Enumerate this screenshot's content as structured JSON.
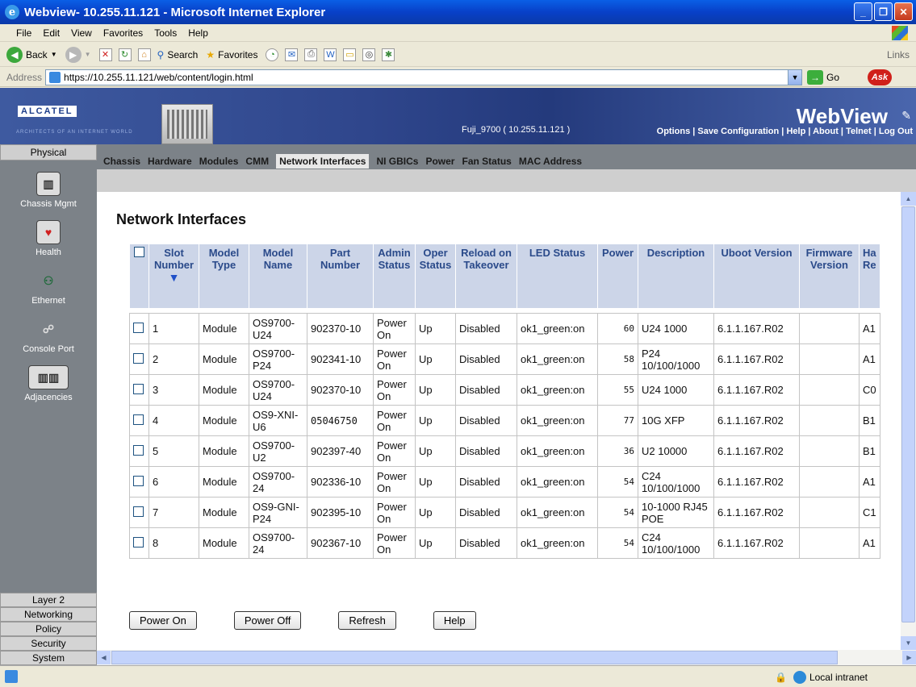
{
  "window": {
    "title": "Webview- 10.255.11.121 - Microsoft Internet Explorer",
    "buttons": [
      "_",
      "❐",
      "✕"
    ]
  },
  "menu": [
    "File",
    "Edit",
    "View",
    "Favorites",
    "Tools",
    "Help"
  ],
  "toolbar": {
    "back": "Back",
    "search": "Search",
    "favorites": "Favorites",
    "links": "Links"
  },
  "address": {
    "label": "Address",
    "url": "https://10.255.11.121/web/content/login.html",
    "go": "Go",
    "ask": "Ask"
  },
  "banner": {
    "logo": "ALCATEL",
    "tagline": "ARCHITECTS OF AN INTERNET WORLD",
    "host": "Fuji_9700  ( 10.255.11.121 )",
    "product": "WebView",
    "links": [
      "Options",
      "Save Configuration",
      "Help",
      "About",
      "Telnet",
      "Log Out"
    ]
  },
  "leftnav": {
    "top": "Physical",
    "items": [
      "Chassis Mgmt",
      "Health",
      "Ethernet",
      "Console Port",
      "Adjacencies"
    ],
    "bottom": [
      "Layer 2",
      "Networking",
      "Policy",
      "Security",
      "System"
    ]
  },
  "tabs": {
    "items": [
      "Chassis",
      "Hardware",
      "Modules",
      "CMM",
      "Network Interfaces",
      "NI GBICs",
      "Power",
      "Fan Status",
      "MAC Address"
    ],
    "active": "Network Interfaces"
  },
  "page": {
    "title": "Network Interfaces"
  },
  "table": {
    "headers": [
      "Slot Number",
      "Model Type",
      "Model Name",
      "Part Number",
      "Admin Status",
      "Oper Status",
      "Reload on Takeover",
      "LED Status",
      "Power",
      "Description",
      "Uboot Version",
      "Firmware Version",
      "Ha Re"
    ],
    "rows": [
      [
        "1",
        "Module",
        "OS9700-U24",
        "902370-10",
        "Power On",
        "Up",
        "Disabled",
        "ok1_green:on",
        "60",
        "U24 1000",
        "6.1.1.167.R02",
        "",
        "A1"
      ],
      [
        "2",
        "Module",
        "OS9700-P24",
        "902341-10",
        "Power On",
        "Up",
        "Disabled",
        "ok1_green:on",
        "58",
        "P24 10/100/1000",
        "6.1.1.167.R02",
        "",
        "A1"
      ],
      [
        "3",
        "Module",
        "OS9700-U24",
        "902370-10",
        "Power On",
        "Up",
        "Disabled",
        "ok1_green:on",
        "55",
        "U24 1000",
        "6.1.1.167.R02",
        "",
        "C0"
      ],
      [
        "4",
        "Module",
        "OS9-XNI-U6",
        "05046750",
        "Power On",
        "Up",
        "Disabled",
        "ok1_green:on",
        "77",
        "10G XFP",
        "6.1.1.167.R02",
        "",
        "B1"
      ],
      [
        "5",
        "Module",
        "OS9700-U2",
        "902397-40",
        "Power On",
        "Up",
        "Disabled",
        "ok1_green:on",
        "36",
        "U2 10000",
        "6.1.1.167.R02",
        "",
        "B1"
      ],
      [
        "6",
        "Module",
        "OS9700-24",
        "902336-10",
        "Power On",
        "Up",
        "Disabled",
        "ok1_green:on",
        "54",
        "C24 10/100/1000",
        "6.1.1.167.R02",
        "",
        "A1"
      ],
      [
        "7",
        "Module",
        "OS9-GNI-P24",
        "902395-10",
        "Power On",
        "Up",
        "Disabled",
        "ok1_green:on",
        "54",
        "10-1000 RJ45 POE",
        "6.1.1.167.R02",
        "",
        "C1"
      ],
      [
        "8",
        "Module",
        "OS9700-24",
        "902367-10",
        "Power On",
        "Up",
        "Disabled",
        "ok1_green:on",
        "54",
        "C24 10/100/1000",
        "6.1.1.167.R02",
        "",
        "A1"
      ]
    ]
  },
  "buttons": [
    "Power On",
    "Power Off",
    "Refresh",
    "Help"
  ],
  "status": {
    "zone": "Local intranet"
  }
}
